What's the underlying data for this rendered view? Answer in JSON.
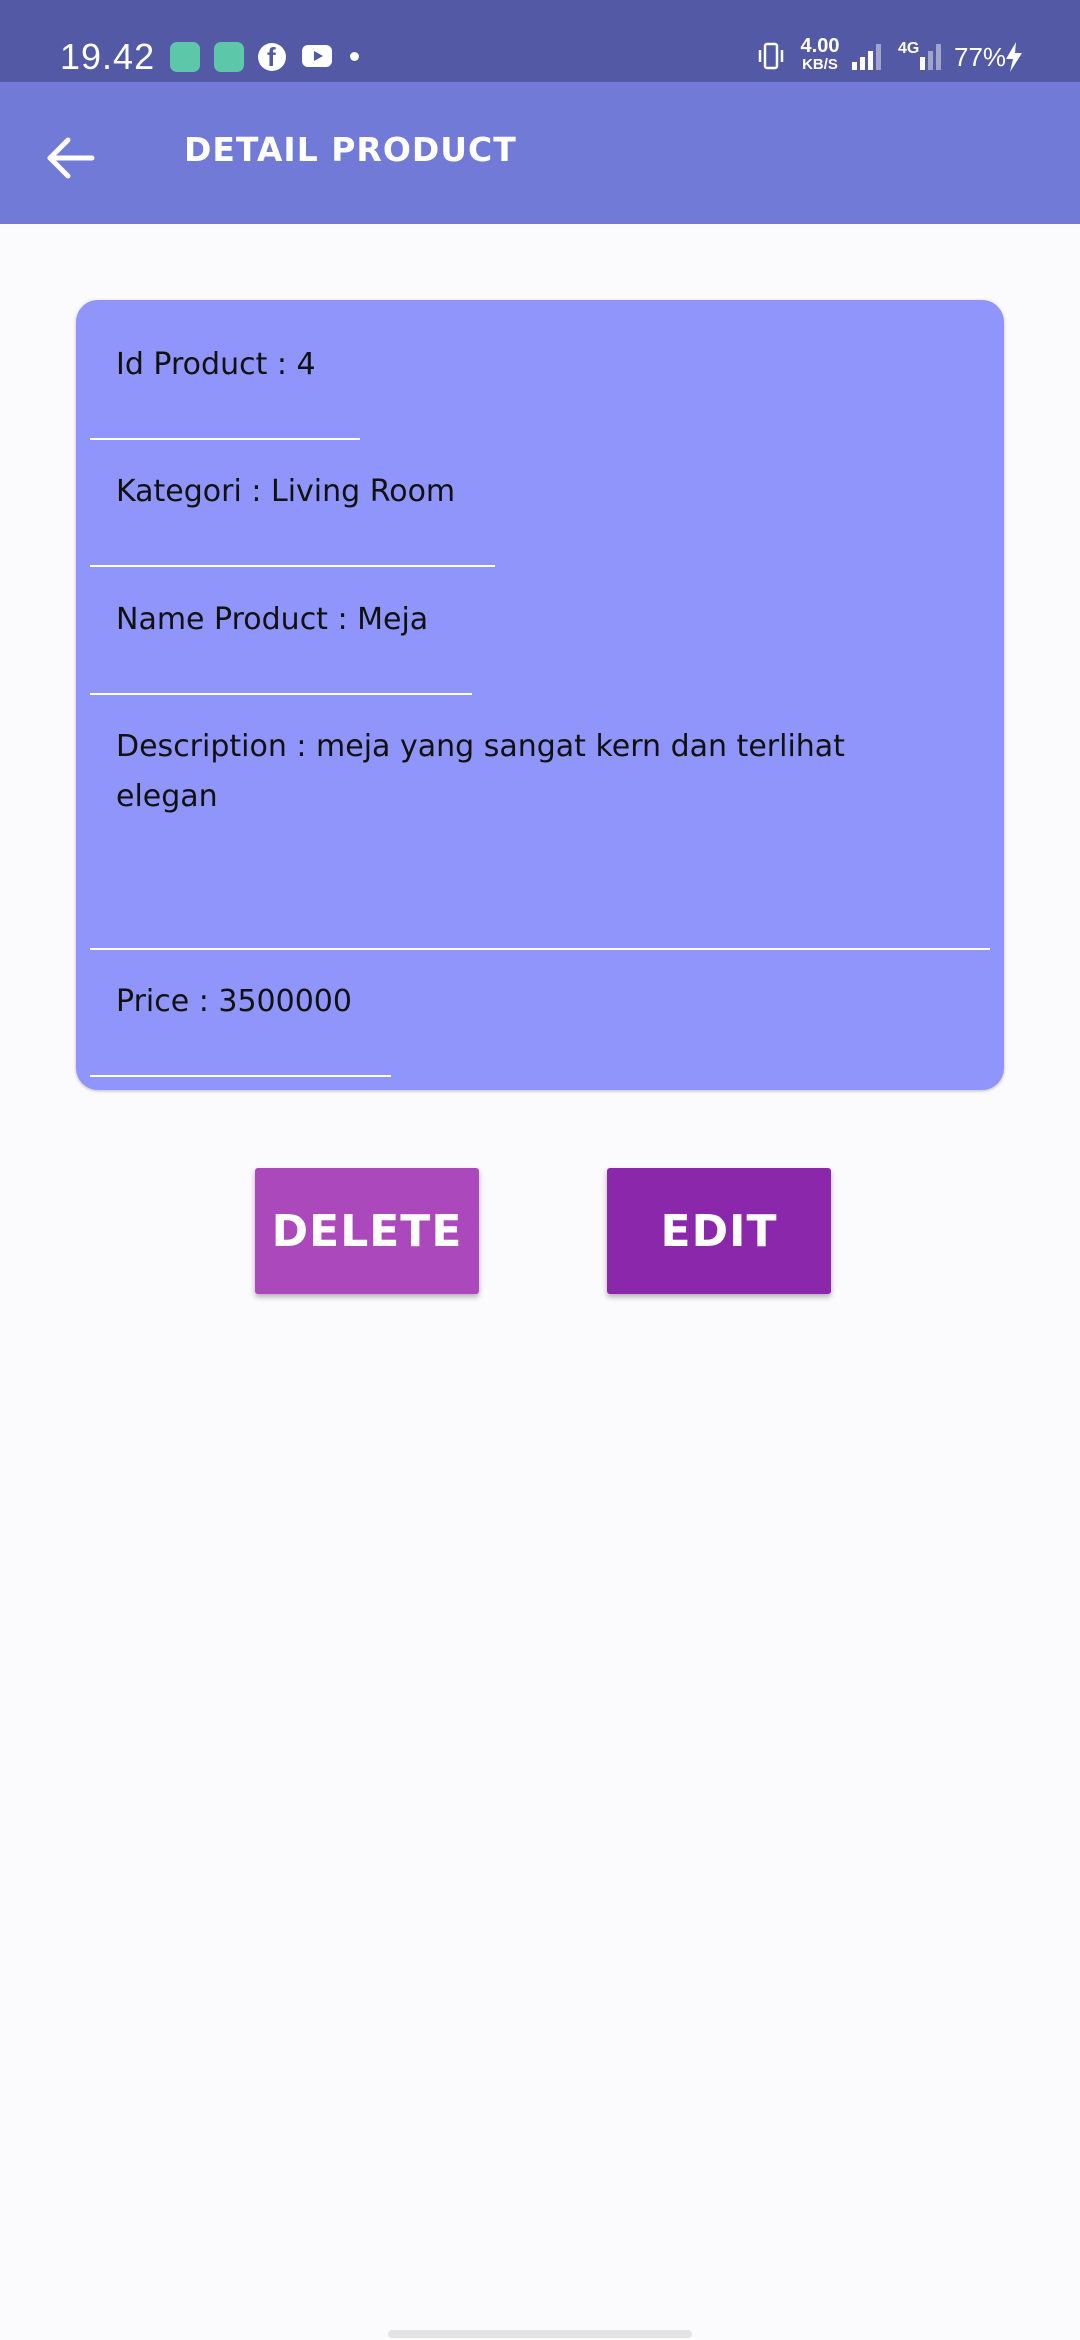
{
  "status_bar": {
    "time": "19.42",
    "speed_value": "4.00",
    "speed_unit": "KB/S",
    "network": "4G",
    "battery": "77%",
    "icons": [
      "app-icon",
      "app-icon",
      "facebook-icon",
      "youtube-icon",
      "dot-icon",
      "vibrate-icon",
      "signal-icon",
      "signal-icon",
      "charging-icon"
    ]
  },
  "app_bar": {
    "title": "DETAIL PRODUCT",
    "back_icon": "arrow-left-icon"
  },
  "detail": {
    "id_line": "Id Product : 4",
    "category_line": "Kategori : Living Room",
    "name_line": "Name Product : Meja",
    "description_line": "Description : meja yang sangat kern dan terlihat elegan",
    "price_line": "Price : 3500000"
  },
  "actions": {
    "delete_label": "DELETE",
    "edit_label": "EDIT"
  },
  "colors": {
    "status_bar": "#5359a4",
    "app_bar": "#727ad8",
    "card": "#8f95fa",
    "delete_button": "#ab48bb",
    "edit_button": "#8a27ab",
    "background": "#fbfbfe"
  }
}
